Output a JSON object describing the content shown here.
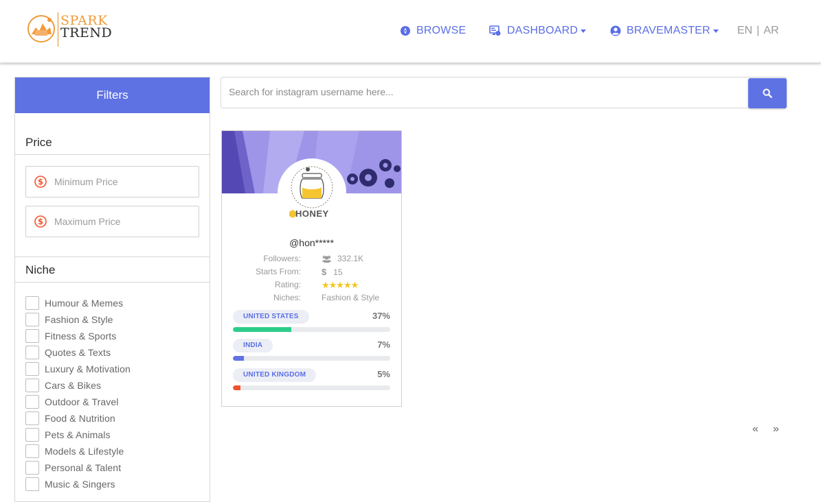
{
  "brand": {
    "line1": "SPARK",
    "line2": "TREND",
    "accent": "#ef9b3a"
  },
  "nav": {
    "browse": "BROWSE",
    "dashboard": "DASHBOARD",
    "user": "BRAVEMASTER",
    "lang_en": "EN",
    "lang_sep": "|",
    "lang_ar": "AR"
  },
  "sidebar": {
    "filters_title": "Filters",
    "price_title": "Price",
    "min_price_placeholder": "Minimum Price",
    "max_price_placeholder": "Maximum Price",
    "niche_title": "Niche",
    "niches": [
      "Humour & Memes",
      "Fashion & Style",
      "Fitness & Sports",
      "Quotes & Texts",
      "Luxury & Motivation",
      "Cars & Bikes",
      "Outdoor & Travel",
      "Food & Nutrition",
      "Pets & Animals",
      "Models & Lifestyle",
      "Personal & Talent",
      "Music & Singers"
    ]
  },
  "search": {
    "placeholder": "Search for instagram username here..."
  },
  "card": {
    "avatar_text": "HONEY",
    "username": "@hon*****",
    "followers_label": "Followers:",
    "followers_value": "332.1K",
    "starts_label": "Starts From:",
    "starts_currency": "$",
    "starts_value": "15",
    "rating_label": "Rating:",
    "rating_stars": "★★★★★",
    "rating": 5,
    "niches_label": "Niches:",
    "niches_value": "Fashion & Style",
    "countries": [
      {
        "name": "UNITED STATES",
        "pct": "37%",
        "value": 37,
        "color": "#2ecc8a"
      },
      {
        "name": "INDIA",
        "pct": "7%",
        "value": 7,
        "color": "#5f72e3"
      },
      {
        "name": "UNITED KINGDOM",
        "pct": "5%",
        "value": 5,
        "color": "#f0532d"
      }
    ]
  },
  "pager": {
    "prev": "«",
    "next": "»"
  },
  "colors": {
    "primary": "#5f72e3",
    "muted": "#9a9a9a"
  }
}
